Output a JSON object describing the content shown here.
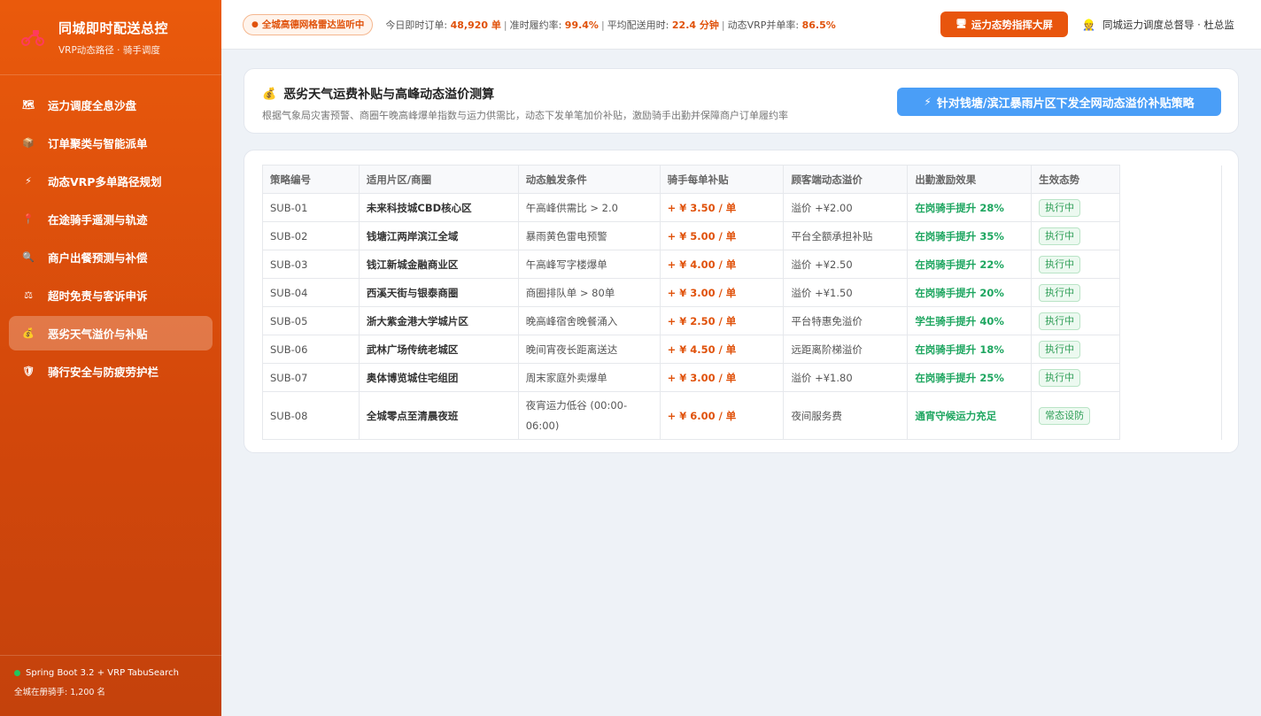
{
  "brand": {
    "title": "同城即时配送总控",
    "subtitle": "VRP动态路径 · 骑手调度"
  },
  "nav": [
    {
      "label": "运力调度全息沙盘",
      "icon": "map-icon"
    },
    {
      "label": "订单聚类与智能派单",
      "icon": "package-icon"
    },
    {
      "label": "动态VRP多单路径规划",
      "icon": "lightning-icon"
    },
    {
      "label": "在途骑手遥测与轨迹",
      "icon": "pin-icon"
    },
    {
      "label": "商户出餐预测与补偿",
      "icon": "search-icon"
    },
    {
      "label": "超时免责与客诉申诉",
      "icon": "scale-icon"
    },
    {
      "label": "恶劣天气溢价与补贴",
      "icon": "money-bag-icon",
      "active": true
    },
    {
      "label": "骑行安全与防疲劳护栏",
      "icon": "shield-icon"
    }
  ],
  "footer": {
    "tech": "Spring Boot 3.2 + VRP TabuSearch",
    "riders": "全城在册骑手: 1,200 名"
  },
  "topbar": {
    "radar": "全城高德网格雷达监听中",
    "stats": [
      {
        "label": "今日即时订单:",
        "value": "48,920 单"
      },
      {
        "label": "准时履约率:",
        "value": "99.4%"
      },
      {
        "label": "平均配送用时:",
        "value": "22.4 分钟"
      },
      {
        "label": "动态VRP并单率:",
        "value": "86.5%"
      }
    ],
    "big_screen_label": "运力态势指挥大屏",
    "user": "同城运力调度总督导 · 杜总监"
  },
  "header": {
    "title": "恶劣天气运费补贴与高峰动态溢价测算",
    "desc": "根据气象局灾害预警、商圈午晚高峰爆单指数与运力供需比，动态下发单笔加价补贴，激励骑手出勤并保障商户订单履约率",
    "policy_button": "针对钱塘/滨江暴雨片区下发全网动态溢价补贴策略"
  },
  "table": {
    "columns": [
      "策略编号",
      "适用片区/商圈",
      "动态触发条件",
      "骑手每单补贴",
      "顾客端动态溢价",
      "出勤激励效果",
      "生效态势"
    ],
    "rows": [
      {
        "id": "SUB-01",
        "area": "未来科技城CBD核心区",
        "cond": "午高峰供需比 > 2.0",
        "sub": "+ ¥ 3.50 / 单",
        "premium": "溢价 +¥2.00",
        "effect": "在岗骑手提升 28%",
        "status": "执行中"
      },
      {
        "id": "SUB-02",
        "area": "钱塘江两岸滨江全域",
        "cond": "暴雨黄色雷电预警",
        "sub": "+ ¥ 5.00 / 单",
        "premium": "平台全额承担补贴",
        "effect": "在岗骑手提升 35%",
        "status": "执行中"
      },
      {
        "id": "SUB-03",
        "area": "钱江新城金融商业区",
        "cond": "午高峰写字楼爆单",
        "sub": "+ ¥ 4.00 / 单",
        "premium": "溢价 +¥2.50",
        "effect": "在岗骑手提升 22%",
        "status": "执行中"
      },
      {
        "id": "SUB-04",
        "area": "西溪天街与银泰商圈",
        "cond": "商圈排队单 > 80单",
        "sub": "+ ¥ 3.00 / 单",
        "premium": "溢价 +¥1.50",
        "effect": "在岗骑手提升 20%",
        "status": "执行中"
      },
      {
        "id": "SUB-05",
        "area": "浙大紫金港大学城片区",
        "cond": "晚高峰宿舍晚餐涌入",
        "sub": "+ ¥ 2.50 / 单",
        "premium": "平台特惠免溢价",
        "effect": "学生骑手提升 40%",
        "status": "执行中"
      },
      {
        "id": "SUB-06",
        "area": "武林广场传统老城区",
        "cond": "晚间宵夜长距离送达",
        "sub": "+ ¥ 4.50 / 单",
        "premium": "远距离阶梯溢价",
        "effect": "在岗骑手提升 18%",
        "status": "执行中"
      },
      {
        "id": "SUB-07",
        "area": "奥体博览城住宅组团",
        "cond": "周末家庭外卖爆单",
        "sub": "+ ¥ 3.00 / 单",
        "premium": "溢价 +¥1.80",
        "effect": "在岗骑手提升 25%",
        "status": "执行中"
      },
      {
        "id": "SUB-08",
        "area": "全城零点至清晨夜班",
        "cond": "夜宵运力低谷 (00:00-06:00)",
        "sub": "+ ¥ 6.00 / 单",
        "premium": "夜间服务费",
        "effect": "通宵守候运力充足",
        "status": "常态设防"
      }
    ]
  },
  "colors": {
    "accent": "#e8550d",
    "sidebar": "#d94c0b",
    "primary_button": "#4a9ef7",
    "success": "#1ea660"
  }
}
